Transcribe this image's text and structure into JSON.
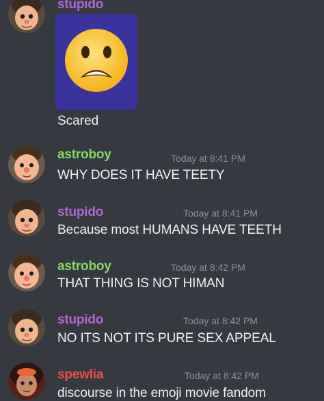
{
  "colors": {
    "background": "#36393f",
    "stupido": "#b266d6",
    "astroboy": "#86d966",
    "spewlia": "#ef4b4b",
    "timestamp": "#8e9297",
    "message_text": "#f2f3f5",
    "emoji_card_bg": "#3a339e"
  },
  "messages": [
    {
      "user": "stupido",
      "avatar_icon": "boy-avatar-icon",
      "attachment": {
        "icon": "anguished-face-emoji-icon",
        "caption": "Scared"
      }
    },
    {
      "user": "astroboy",
      "timestamp": "Today at 8:41 PM",
      "text": "WHY DOES IT HAVE TEETY",
      "avatar_icon": "boy-avatar-icon"
    },
    {
      "user": "stupido",
      "timestamp": "Today at 8:41 PM",
      "text": "Because most HUMANS HAVE TEETH",
      "avatar_icon": "boy-avatar-icon"
    },
    {
      "user": "astroboy",
      "timestamp": "Today at 8:42 PM",
      "text": "THAT THING IS NOT HIMAN",
      "avatar_icon": "boy-avatar-icon"
    },
    {
      "user": "stupido",
      "timestamp": "Today at 8:42 PM",
      "text": "NO ITS NOT ITS PURE SEX APPEAL",
      "avatar_icon": "boy-avatar-icon"
    },
    {
      "user": "spewlia",
      "timestamp": "Today at 8:42 PM",
      "text": "discourse in the emoji movie fandom",
      "avatar_icon": "girl-avatar-icon"
    }
  ]
}
